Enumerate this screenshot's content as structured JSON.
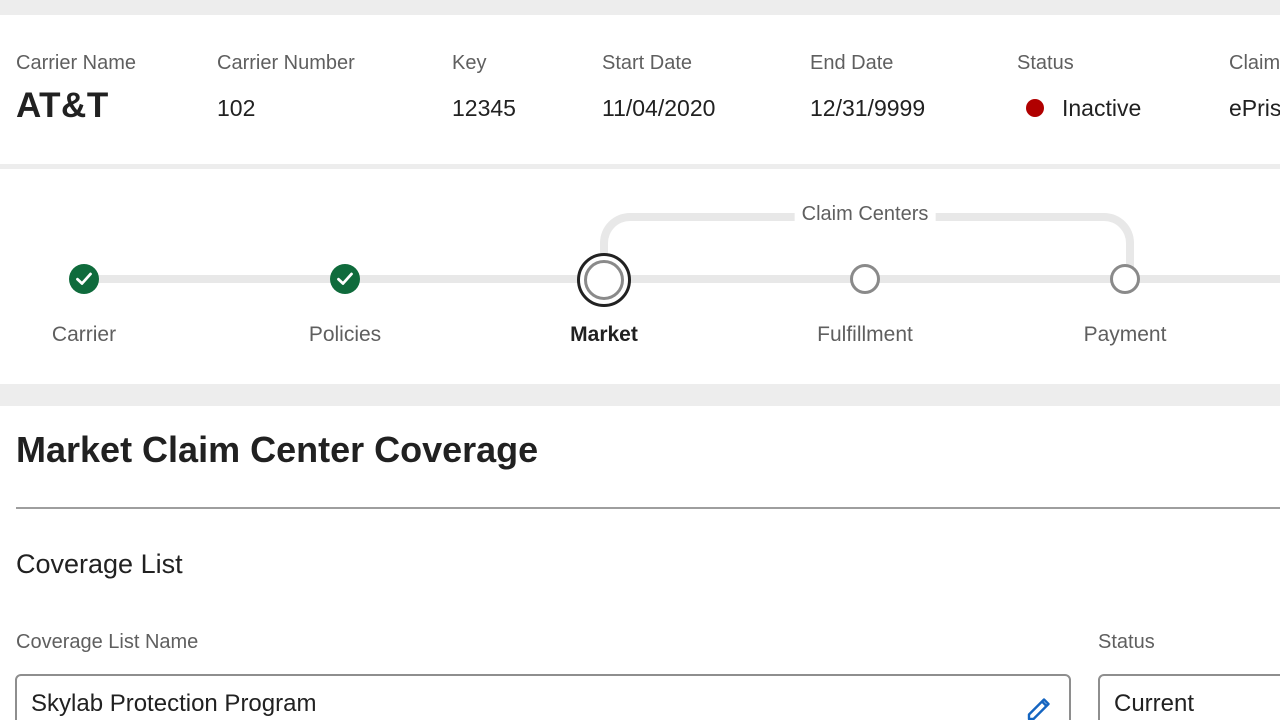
{
  "carrier": {
    "fields": [
      {
        "label": "Carrier Name",
        "value": "AT&T"
      },
      {
        "label": "Carrier Number",
        "value": "102"
      },
      {
        "label": "Key",
        "value": "12345"
      },
      {
        "label": "Start Date",
        "value": "11/04/2020"
      },
      {
        "label": "End Date",
        "value": "12/31/9999"
      },
      {
        "label": "Status",
        "value": "Inactive",
        "status_color": "#b00000"
      },
      {
        "label": "Claim",
        "value": "ePris"
      }
    ]
  },
  "stepper": {
    "group_label": "Claim Centers",
    "steps": [
      {
        "label": "Carrier",
        "state": "complete"
      },
      {
        "label": "Policies",
        "state": "complete"
      },
      {
        "label": "Market",
        "state": "current"
      },
      {
        "label": "Fulfillment",
        "state": "incomplete"
      },
      {
        "label": "Payment",
        "state": "incomplete"
      }
    ],
    "complete_color": "#0f6b3c"
  },
  "main": {
    "title": "Market Claim Center Coverage",
    "section_title": "Coverage List",
    "coverage_name": {
      "label": "Coverage List Name",
      "value": "Skylab Protection Program",
      "icon": "pencil-edit-icon"
    },
    "status": {
      "label": "Status",
      "value": "Current"
    },
    "accent_color": "#1565c0"
  }
}
